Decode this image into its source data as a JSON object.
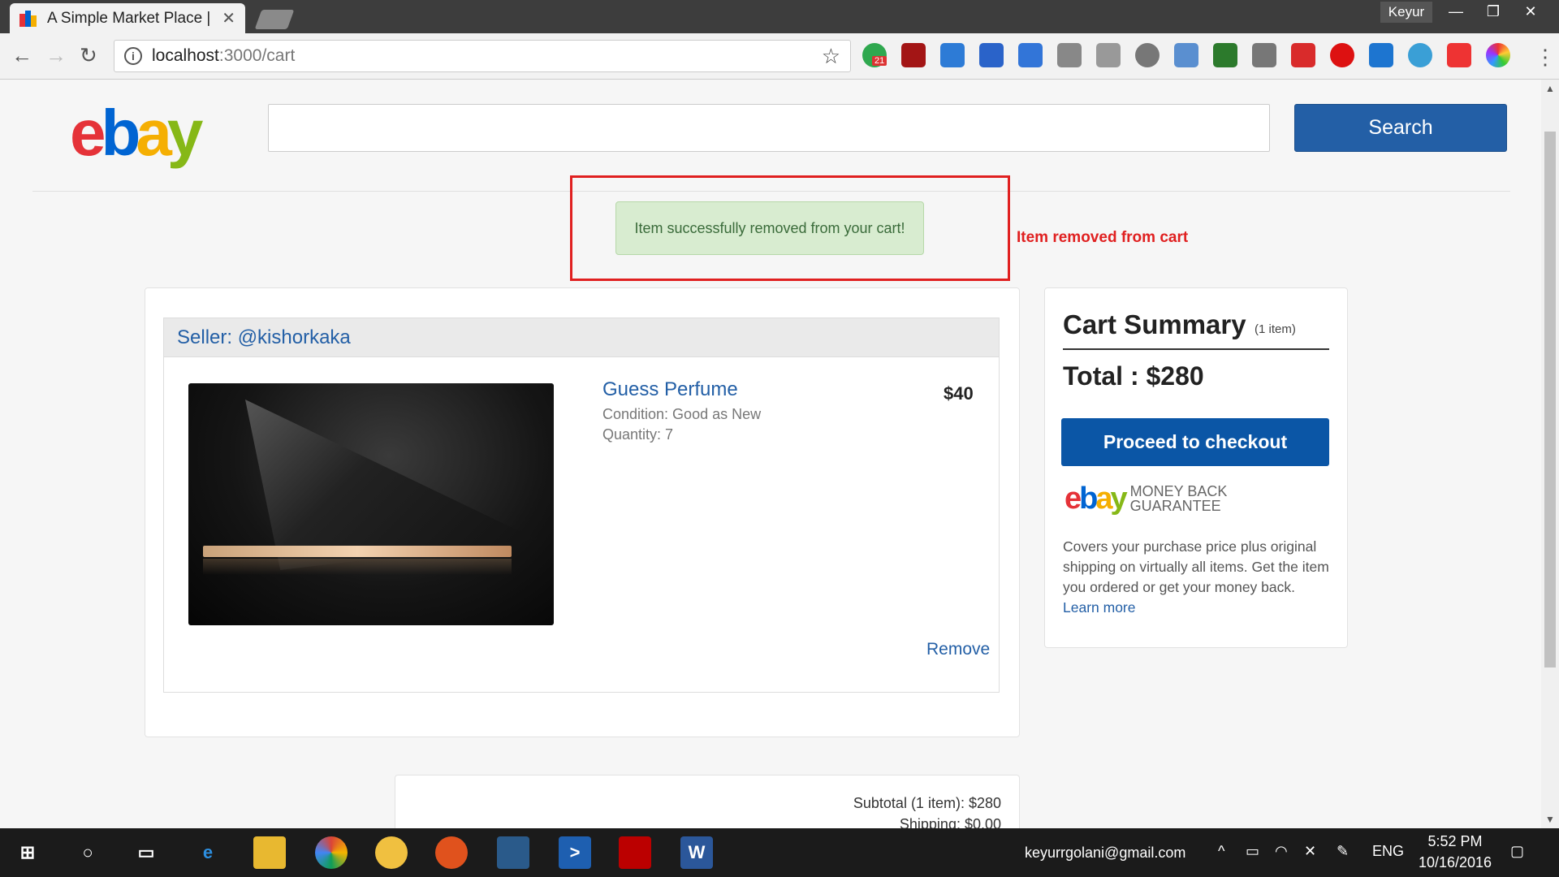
{
  "browser": {
    "tab_title": "A Simple Market Place | e",
    "profile_name": "Keyur",
    "url_host": "localhost",
    "url_path": ":3000/cart",
    "extension_badge": "21"
  },
  "header": {
    "logo_text": "ebay",
    "logo_colors": [
      "#e53238",
      "#0064d2",
      "#f5af02",
      "#86b817"
    ],
    "search_placeholder": "",
    "search_button": "Search"
  },
  "alert": {
    "message": "Item successfully removed from your cart!"
  },
  "annotation": {
    "label": "Item removed from cart",
    "color": "#e02020"
  },
  "cart": {
    "seller_label": "Seller: @kishorkaka",
    "item": {
      "title": "Guess Perfume",
      "condition": "Condition: Good as New",
      "quantity": "Quantity: 7",
      "price": "$40",
      "remove_label": "Remove"
    }
  },
  "summary": {
    "title": "Cart Summary",
    "count": "(1 item)",
    "total": "Total : $280",
    "checkout_button": "Proceed to checkout",
    "guarantee_logo_text": "ebay",
    "guarantee_caption": "MONEY BACK GUARANTEE",
    "description": "Covers your purchase price plus original shipping on virtually all items. Get the item you ordered or get your money back.",
    "learn_more": "Learn more"
  },
  "subtotal": {
    "subtotal_text": "Subtotal (1 item): $280",
    "shipping_text": "Shipping: $0.00"
  },
  "taskbar": {
    "email": "keyurrgolani@gmail.com",
    "language": "ENG",
    "time": "5:52 PM",
    "date": "10/16/2016"
  }
}
